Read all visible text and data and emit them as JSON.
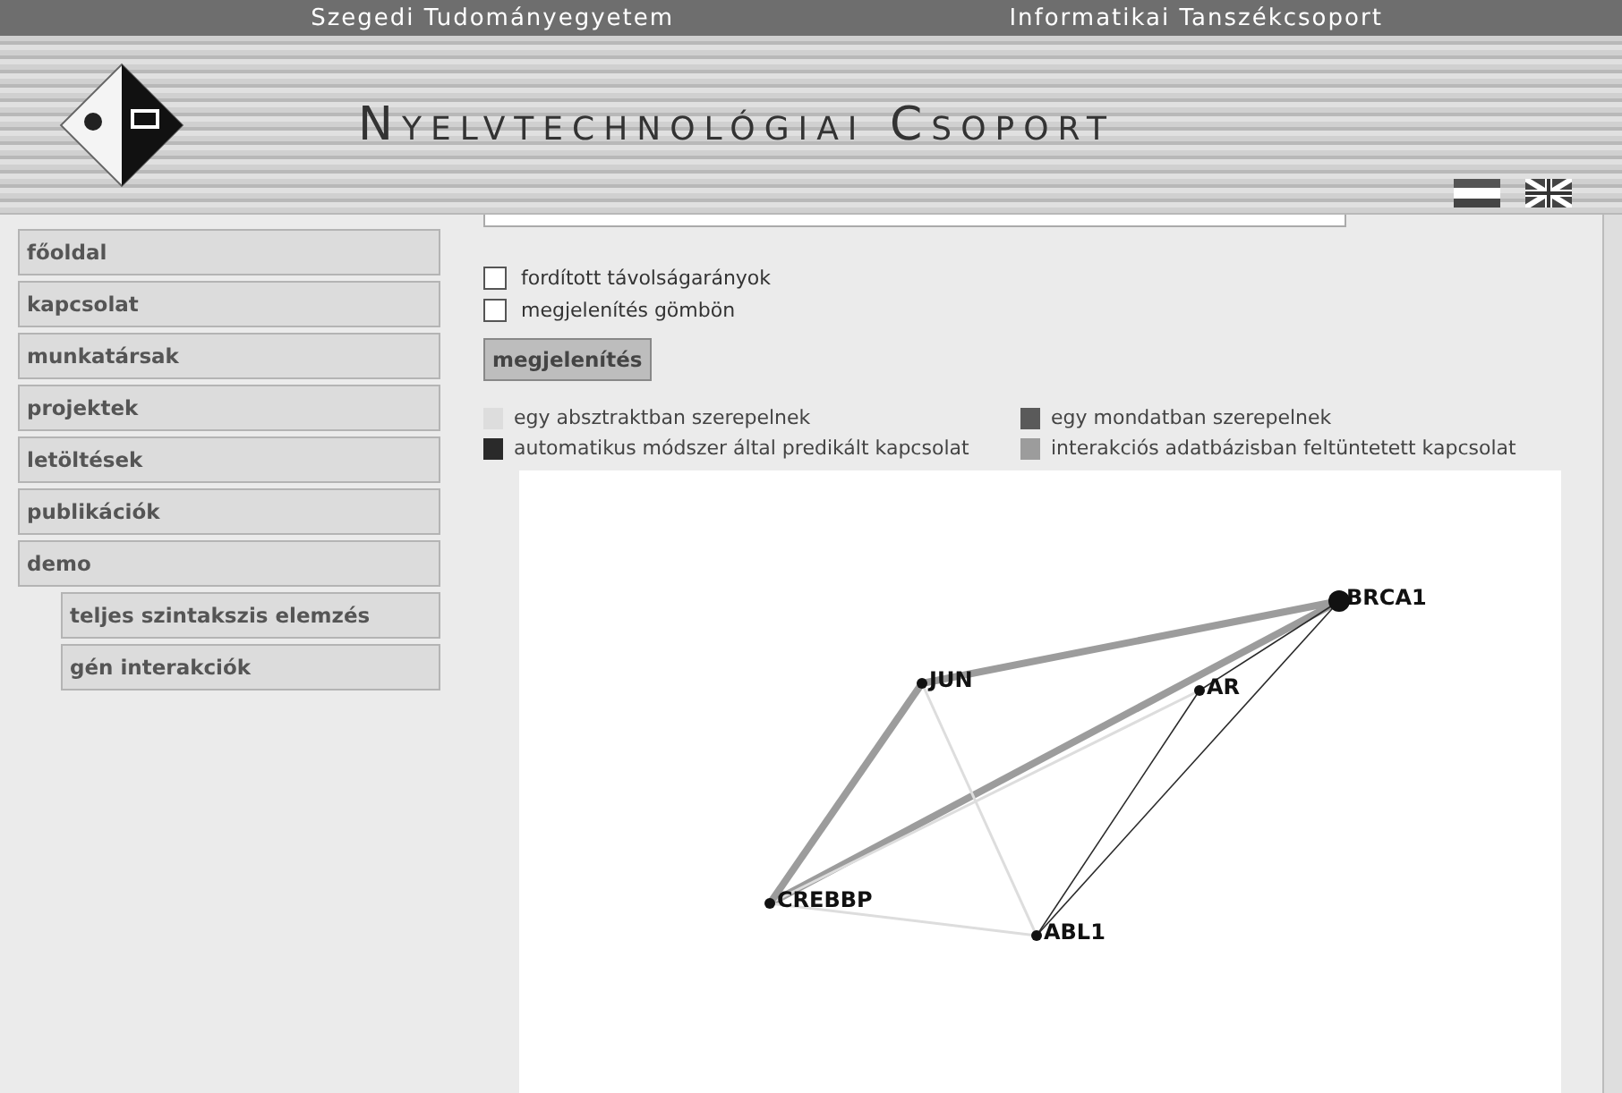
{
  "top_bar": {
    "left": "Szegedi Tudományegyetem",
    "right": "Informatikai Tanszékcsoport"
  },
  "banner": {
    "title": "Nyelvtechnológiai Csoport"
  },
  "sidebar": {
    "items": [
      {
        "label": "főoldal"
      },
      {
        "label": "kapcsolat"
      },
      {
        "label": "munkatársak"
      },
      {
        "label": "projektek"
      },
      {
        "label": "letöltések"
      },
      {
        "label": "publikációk"
      },
      {
        "label": "demo",
        "children": [
          {
            "label": "teljes szintakszis elemzés"
          },
          {
            "label": "gén interakciók"
          }
        ]
      }
    ]
  },
  "options": [
    {
      "label": "fordított távolságarányok",
      "checked": false
    },
    {
      "label": "megjelenítés gömbön",
      "checked": false
    }
  ],
  "submit_button": "megjelenítés",
  "legend": [
    {
      "kind": "abstract",
      "label": "egy absztraktban szerepelnek",
      "color": "#dddddd"
    },
    {
      "kind": "sentence",
      "label": "egy mondatban szerepelnek",
      "color": "#5a5a5a"
    },
    {
      "kind": "predicted",
      "label": "automatikus módszer által predikált kapcsolat",
      "color": "#2a2a2a"
    },
    {
      "kind": "database",
      "label": "interakciós adatbázisban feltüntetett kapcsolat",
      "color": "#9c9c9c"
    }
  ],
  "graph": {
    "nodes": [
      {
        "label": "BRCA1"
      },
      {
        "label": "JUN"
      },
      {
        "label": "AR"
      },
      {
        "label": "CREBBP"
      },
      {
        "label": "ABL1"
      }
    ]
  }
}
